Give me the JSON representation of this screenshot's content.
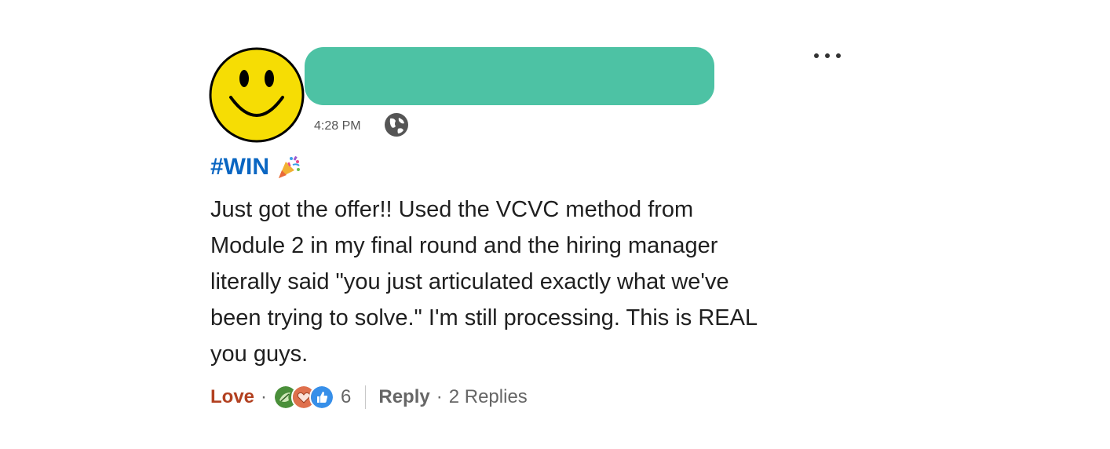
{
  "comment": {
    "author_avatar_icon": "smiley-face-icon",
    "author_name_redaction_color": "#4dc2a4",
    "more_icon": "ellipsis-icon",
    "more_label": "···",
    "timestamp": "4:28 PM",
    "visibility_icon": "globe-icon",
    "hashtag": "#WIN",
    "hashtag_icon": "party-popper-icon",
    "body_lines": [
      "Just got the offer!! Used the VCVC method from",
      "Module 2 in my final round and the hiring manager",
      "literally said \"you just articulated exactly what we've",
      "been trying to solve.\" I'm still processing. This is REAL",
      "you guys."
    ]
  },
  "actions": {
    "reaction_label": "Love",
    "separator": "·",
    "reactions": [
      {
        "name": "support-reaction-icon",
        "color": "#4a8f3a"
      },
      {
        "name": "love-reaction-icon",
        "color": "#df704d"
      },
      {
        "name": "like-reaction-icon",
        "color": "#378fe9"
      }
    ],
    "reaction_count": "6",
    "reply_label": "Reply",
    "replies_label": "2 Replies"
  },
  "colors": {
    "hashtag": "#0a66c2",
    "love": "#b24020",
    "muted_text": "#666666"
  }
}
